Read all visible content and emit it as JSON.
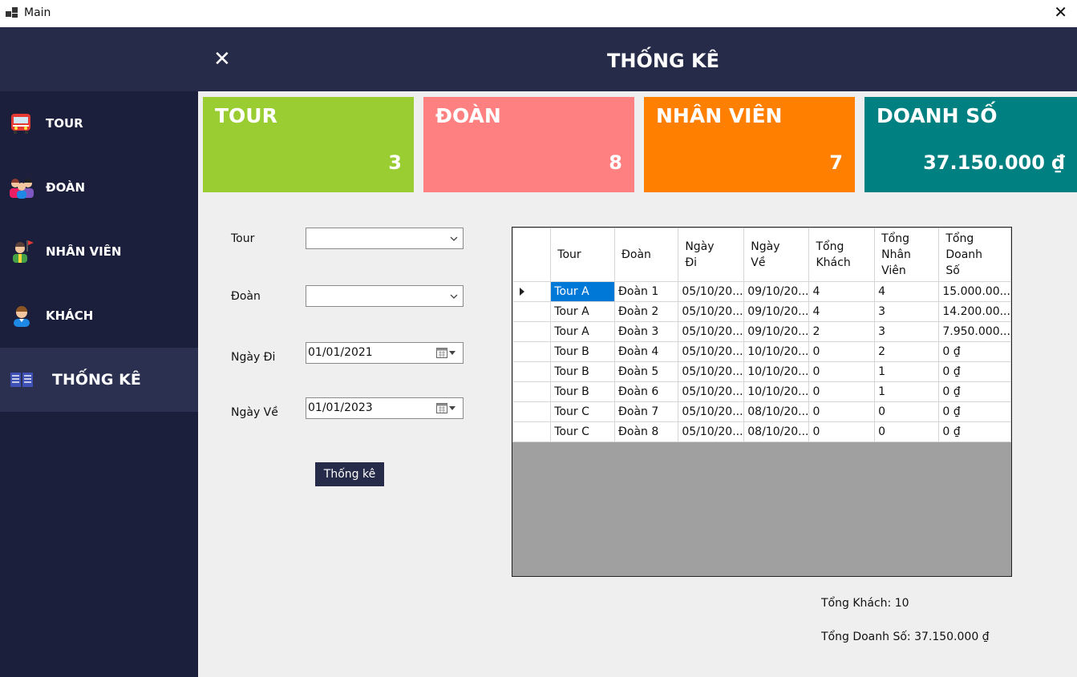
{
  "window": {
    "title": "Main"
  },
  "header": {
    "title": "THỐNG KÊ"
  },
  "sidebar": {
    "items": [
      {
        "label": "TOUR",
        "icon": "bus-icon"
      },
      {
        "label": "ĐOÀN",
        "icon": "group-icon"
      },
      {
        "label": "NHÂN VIÊN",
        "icon": "tour-guide-icon"
      },
      {
        "label": "KHÁCH",
        "icon": "customer-icon"
      },
      {
        "label": "THỐNG KÊ",
        "icon": "statistics-book-icon",
        "active": true
      }
    ]
  },
  "cards": [
    {
      "title": "TOUR",
      "value": "3",
      "color": "#9acd32"
    },
    {
      "title": "ĐOÀN",
      "value": "8",
      "color": "#ff8080"
    },
    {
      "title": "NHÂN VIÊN",
      "value": "7",
      "color": "#ff7f00"
    },
    {
      "title": "DOANH SỐ",
      "value": "37.150.000 ₫",
      "color": "#008080"
    }
  ],
  "form": {
    "tour_label": "Tour",
    "tour_value": "",
    "doan_label": "Đoàn",
    "doan_value": "",
    "ngay_di_label": "Ngày Đi",
    "ngay_di_value": "01/01/2021",
    "ngay_ve_label": "Ngày Về",
    "ngay_ve_value": "01/01/2023",
    "submit_label": "Thống kê"
  },
  "grid": {
    "columns": [
      "Tour",
      "Đoàn",
      "Ngày Đi",
      "Ngày Về",
      "Tổng Khách",
      "Tổng Nhân Viên",
      "Tổng Doanh Số"
    ],
    "rows": [
      [
        "Tour A",
        "Đoàn 1",
        "05/10/20...",
        "09/10/20...",
        "4",
        "4",
        "15.000.00..."
      ],
      [
        "Tour A",
        "Đoàn 2",
        "05/10/20...",
        "09/10/20...",
        "4",
        "3",
        "14.200.00..."
      ],
      [
        "Tour A",
        "Đoàn 3",
        "05/10/20...",
        "09/10/20...",
        "2",
        "3",
        "7.950.000..."
      ],
      [
        "Tour B",
        "Đoàn 4",
        "05/10/20...",
        "10/10/20...",
        "0",
        "2",
        "0 ₫"
      ],
      [
        "Tour B",
        "Đoàn 5",
        "05/10/20...",
        "10/10/20...",
        "0",
        "1",
        "0 ₫"
      ],
      [
        "Tour B",
        "Đoàn 6",
        "05/10/20...",
        "10/10/20...",
        "0",
        "1",
        "0 ₫"
      ],
      [
        "Tour C",
        "Đoàn 7",
        "05/10/20...",
        "08/10/20...",
        "0",
        "0",
        "0 ₫"
      ],
      [
        "Tour C",
        "Đoàn 8",
        "05/10/20...",
        "08/10/20...",
        "0",
        "0",
        "0 ₫"
      ]
    ]
  },
  "summary": {
    "tong_khach": "Tổng Khách: 10",
    "tong_doanh_so": "Tổng Doanh Số: 37.150.000 ₫"
  }
}
